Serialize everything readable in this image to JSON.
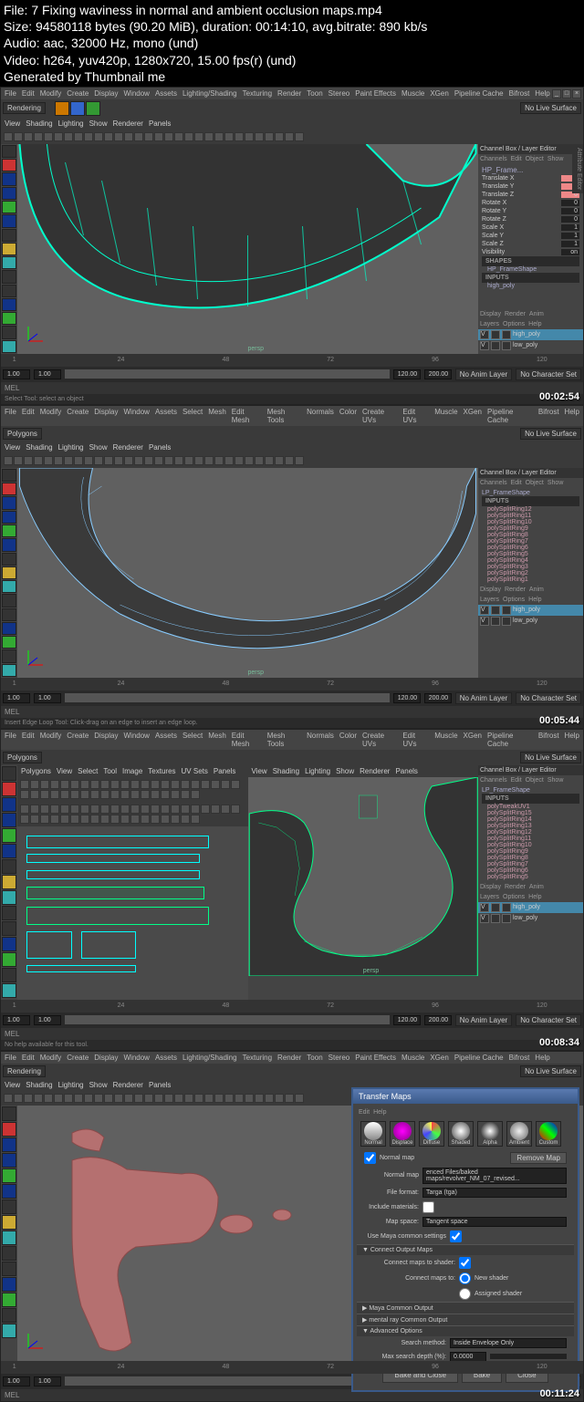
{
  "header": {
    "file": "File: 7 Fixing waviness in normal and ambient occlusion maps.mp4",
    "size": "Size: 94580118 bytes (90.20 MiB), duration: 00:14:10, avg.bitrate: 890 kb/s",
    "audio": "Audio: aac, 32000 Hz, mono (und)",
    "video": "Video: h264, yuv420p, 1280x720, 15.00 fps(r) (und)",
    "gen": "Generated by Thumbnail me"
  },
  "menubar": [
    "File",
    "Edit",
    "Modify",
    "Create",
    "Display",
    "Window",
    "Assets",
    "Lighting/Shading",
    "Texturing",
    "Render",
    "Toon",
    "Stereo",
    "Paint Effects",
    "Muscle",
    "XGen",
    "Pipeline Cache",
    "Bifrost",
    "Help"
  ],
  "menubar2": [
    "File",
    "Edit",
    "Modify",
    "Create",
    "Display",
    "Window",
    "Assets",
    "Select",
    "Mesh",
    "Edit Mesh",
    "Mesh Tools",
    "Normals",
    "Color",
    "Create UVs",
    "Edit UVs",
    "Muscle",
    "XGen",
    "Pipeline Cache",
    "Bifrost",
    "Help"
  ],
  "renderers": {
    "rendering": "Rendering",
    "polygons": "Polygons"
  },
  "viewportMenu": [
    "View",
    "Shading",
    "Lighting",
    "Show",
    "Renderer",
    "Panels"
  ],
  "uvMenu": [
    "Polygons",
    "View",
    "Select",
    "Tool",
    "Image",
    "Textures",
    "UV Sets",
    "Panels"
  ],
  "noLiveSurface": "No Live Surface",
  "channelBox": {
    "title": "Channel Box / Layer Editor",
    "tabs": [
      "Channels",
      "Edit",
      "Object",
      "Show"
    ],
    "pane1": {
      "name": "HP_Frame...",
      "attrs": [
        {
          "l": "Translate X",
          "v": "0",
          "hl": true
        },
        {
          "l": "Translate Y",
          "v": "0",
          "hl": true
        },
        {
          "l": "Translate Z",
          "v": "0",
          "hl": true
        },
        {
          "l": "Rotate X",
          "v": "0"
        },
        {
          "l": "Rotate Y",
          "v": "0"
        },
        {
          "l": "Rotate Z",
          "v": "0"
        },
        {
          "l": "Scale X",
          "v": "1"
        },
        {
          "l": "Scale Y",
          "v": "1"
        },
        {
          "l": "Scale Z",
          "v": "1"
        },
        {
          "l": "Visibility",
          "v": "on"
        }
      ],
      "shapes": "SHAPES",
      "shapeName": "HP_FrameShape",
      "inputs": "INPUTS",
      "inputName": "high_poly"
    },
    "pane2": {
      "name": "LP_FrameShape",
      "inputs": "INPUTS",
      "list": [
        "polySplitRing12",
        "polySplitRing11",
        "polySplitRing10",
        "polySplitRing9",
        "polySplitRing8",
        "polySplitRing7",
        "polySplitRing6",
        "polySplitRing5",
        "polySplitRing4",
        "polySplitRing3",
        "polySplitRing2",
        "polySplitRing1"
      ]
    },
    "pane3": {
      "name": "LP_FrameShape",
      "inputs": "INPUTS",
      "list": [
        "polyTweakUV1",
        "polySplitRing15",
        "polySplitRing14",
        "polySplitRing13",
        "polySplitRing12",
        "polySplitRing11",
        "polySplitRing10",
        "polySplitRing9",
        "polySplitRing8",
        "polySplitRing7",
        "polySplitRing6",
        "polySplitRing5"
      ]
    },
    "layerTabs": [
      "Display",
      "Render",
      "Anim"
    ],
    "layerMenu": [
      "Layers",
      "Options",
      "Help"
    ],
    "layers": [
      {
        "n": "high_poly",
        "sel": true
      },
      {
        "n": "low_poly",
        "sel": false
      }
    ]
  },
  "timeline": {
    "ticks": [
      "1",
      "24",
      "48",
      "72",
      "96",
      "120"
    ],
    "start": "1.00",
    "startR": "1.00",
    "end": "120.00",
    "endR": "200.00",
    "noAnim": "No Anim Layer",
    "noChar": "No Character Set"
  },
  "mel": "MEL",
  "status": {
    "s1": "Select Tool: select an object",
    "s2": "Insert Edge Loop Tool: Click-drag on an edge to insert an edge loop.",
    "s3": "No help available for this tool."
  },
  "timestamps": [
    "00:02:54",
    "00:05:44",
    "00:08:34",
    "00:11:24"
  ],
  "persp": "persp",
  "dialog": {
    "title": "Transfer Maps",
    "menu": [
      "Edit",
      "Help"
    ],
    "maps": [
      "Normal",
      "Displace",
      "Diffuse",
      "Shaded",
      "Alpha",
      "Ambient",
      "Custom"
    ],
    "normalMap": "Normal map",
    "normalPath": "enced Files/baked maps/revolver_NM_07_revised...",
    "removeMap": "Remove Map",
    "fileFormat": "File format:",
    "fileFormatV": "Targa (tga)",
    "includeMat": "Include materials:",
    "mapSpace": "Map space:",
    "mapSpaceV": "Tangent space",
    "useMaya": "Use Maya common settings",
    "connectOut": "Connect Output Maps",
    "connectShader": "Connect maps to shader:",
    "connectTo": "Connect maps to:",
    "newShader": "New shader",
    "assignedShader": "Assigned shader",
    "mayaCommon": "Maya Common Output",
    "mentalRay": "mental ray Common Output",
    "advanced": "Advanced Options",
    "searchMethod": "Search method:",
    "searchMethodV": "Inside Envelope Only",
    "maxDepth": "Max search depth (%):",
    "maxDepthV": "0.0000",
    "btns": [
      "Bake and Close",
      "Bake",
      "Close"
    ]
  }
}
